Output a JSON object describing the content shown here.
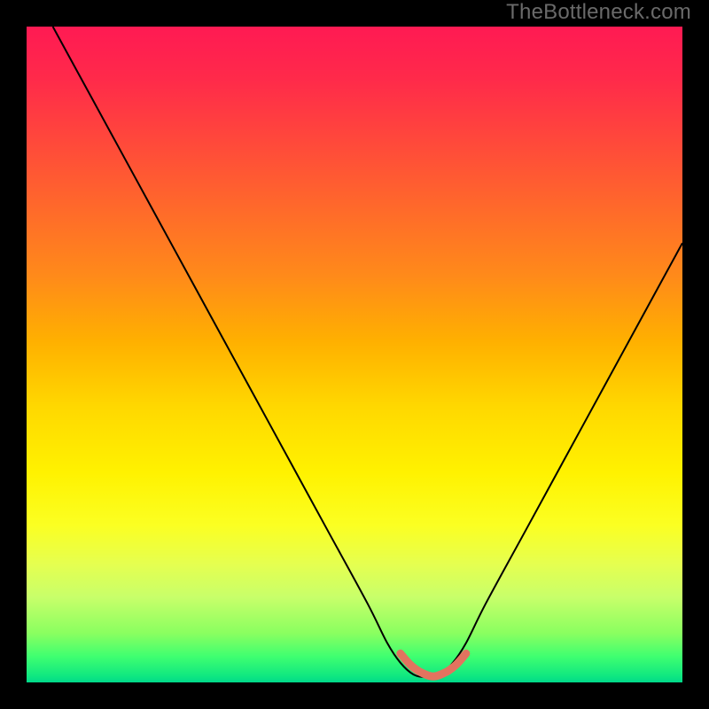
{
  "watermark": "TheBottleneck.com",
  "colors": {
    "background": "#000000",
    "gradient_top": "#ff1a53",
    "gradient_mid": "#ffe000",
    "gradient_bottom": "#00d88a",
    "curve": "#000000",
    "dip_marker": "#e2735f"
  },
  "chart_data": {
    "type": "line",
    "title": "",
    "xlabel": "",
    "ylabel": "",
    "xlim": [
      0,
      100
    ],
    "ylim": [
      0,
      100
    ],
    "series": [
      {
        "name": "bottleneck-curve",
        "x": [
          4,
          10,
          16,
          22,
          28,
          34,
          40,
          46,
          52,
          55,
          57,
          59,
          61,
          63,
          65,
          67,
          70,
          76,
          82,
          88,
          94,
          100
        ],
        "values": [
          100,
          89,
          78,
          67,
          56,
          45,
          34,
          23,
          12,
          6,
          3,
          1.2,
          0.8,
          1.2,
          3,
          6,
          12,
          23,
          34,
          45,
          56,
          67
        ]
      }
    ],
    "annotations": [
      {
        "name": "optimal-dip",
        "x_range": [
          57,
          67
        ],
        "y": 0.9
      }
    ]
  }
}
